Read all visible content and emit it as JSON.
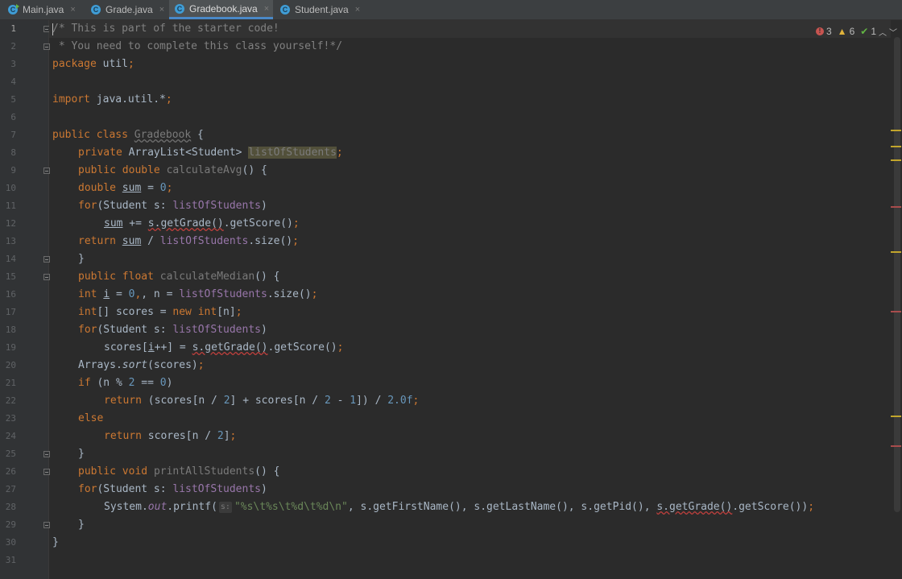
{
  "tabs": [
    {
      "label": "Main.java",
      "close": "×"
    },
    {
      "label": "Grade.java",
      "close": "×"
    },
    {
      "label": "Gradebook.java",
      "close": "×"
    },
    {
      "label": "Student.java",
      "close": "×"
    }
  ],
  "inspections": {
    "errors": "3",
    "warnings": "6",
    "weak_warnings": "1"
  },
  "line_numbers": [
    "1",
    "2",
    "3",
    "4",
    "5",
    "6",
    "7",
    "8",
    "9",
    "10",
    "11",
    "12",
    "13",
    "14",
    "15",
    "16",
    "17",
    "18",
    "19",
    "20",
    "21",
    "22",
    "23",
    "24",
    "25",
    "26",
    "27",
    "28",
    "29",
    "30",
    "31"
  ],
  "colors": {
    "background": "#2b2b2b",
    "keyword": "#cc7832",
    "field": "#9876aa",
    "string": "#6a8759",
    "number": "#6897bb",
    "comment": "#808080",
    "default_text": "#a9b7c6"
  },
  "code": {
    "l1": {
      "comment": "/* This is part of the starter code!"
    },
    "l2": {
      "comment": " * You need to complete this class yourself!*/"
    },
    "l3": {
      "kw": "package",
      "rest": " util",
      "semi": ";"
    },
    "l5": {
      "kw": "import",
      "rest": " java.util.*",
      "semi": ";"
    },
    "l7": {
      "kw1": "public",
      "kw2": "class",
      "name": "Gradebook",
      "brace": " {"
    },
    "l8": {
      "kw": "private",
      "type": " ArrayList<Student> ",
      "field": "listOfStudents",
      "semi": ";"
    },
    "l9": {
      "kw1": "public",
      "kw2": "double",
      "method": "calculateAvg",
      "rest": "() {"
    },
    "l10": {
      "kw": "double",
      "var": "sum",
      "eq": " = ",
      "num": "0",
      "semi": ";"
    },
    "l11": {
      "kw": "for",
      "open": "(Student s: ",
      "field": "listOfStudents",
      "close": ")"
    },
    "l12": {
      "var": "sum",
      "op": " += ",
      "call": "s.getGrade()",
      "rest": ".getScore()",
      "semi": ";"
    },
    "l13": {
      "kw": "return",
      "var": "sum",
      "op": " / ",
      "field": "listOfStudents",
      "rest": ".size()",
      "semi": ";"
    },
    "l14": {
      "text": "}"
    },
    "l15": {
      "kw1": "public",
      "kw2": "float",
      "method": "calculateMedian",
      "rest": "() {"
    },
    "l16": {
      "kw": "int",
      "var": "i",
      "eq": " = ",
      "num": "0",
      "sep": ", n = ",
      "field": "listOfStudents",
      "rest": ".size()",
      "semi": ";"
    },
    "l17": {
      "kw": "int",
      "mid": "[] scores = ",
      "kw2": "new",
      "kw3": "int",
      "rest": "[n]",
      "semi": ";"
    },
    "l18": {
      "kw": "for",
      "open": "(Student s: ",
      "field": "listOfStudents",
      "close": ")"
    },
    "l19": {
      "pre": "scores[",
      "var": "i",
      "mid": "++] = ",
      "call": "s.getGrade()",
      "rest": ".getScore()",
      "semi": ";"
    },
    "l20": {
      "pre": "Arrays.",
      "method": "sort",
      "rest": "(scores)",
      "semi": ";"
    },
    "l21": {
      "kw": "if",
      "a": " (n % ",
      "n1": "2",
      "b": " == ",
      "n2": "0",
      "c": ")"
    },
    "l22": {
      "kw": "return",
      "a": " (scores[n / ",
      "n1": "2",
      "b": "] + scores[n / ",
      "n2": "2",
      "c": " - ",
      "n3": "1",
      "d": "]) / ",
      "n4": "2.0f",
      "semi": ";"
    },
    "l23": {
      "kw": "else"
    },
    "l24": {
      "kw": "return",
      "a": " scores[n / ",
      "n1": "2",
      "b": "]",
      "semi": ";"
    },
    "l25": {
      "text": "}"
    },
    "l26": {
      "kw1": "public",
      "kw2": "void",
      "method": "printAllStudents",
      "rest": "() {"
    },
    "l27": {
      "kw": "for",
      "open": "(Student s: ",
      "field": "listOfStudents",
      "close": ")"
    },
    "l28": {
      "pre": "System.",
      "out": "out",
      "mid": ".printf(",
      "hint": "s:",
      "str": "\"%s\\t%s\\t%d\\t%d\\n\"",
      "rest1": ", s.getFirstName(), s.getLastName(), s.getPid(), ",
      "call": "s.getGrade()",
      "rest2": ".getScore())",
      "semi": ";"
    },
    "l29": {
      "text": "}"
    },
    "l30": {
      "text": "}"
    }
  }
}
